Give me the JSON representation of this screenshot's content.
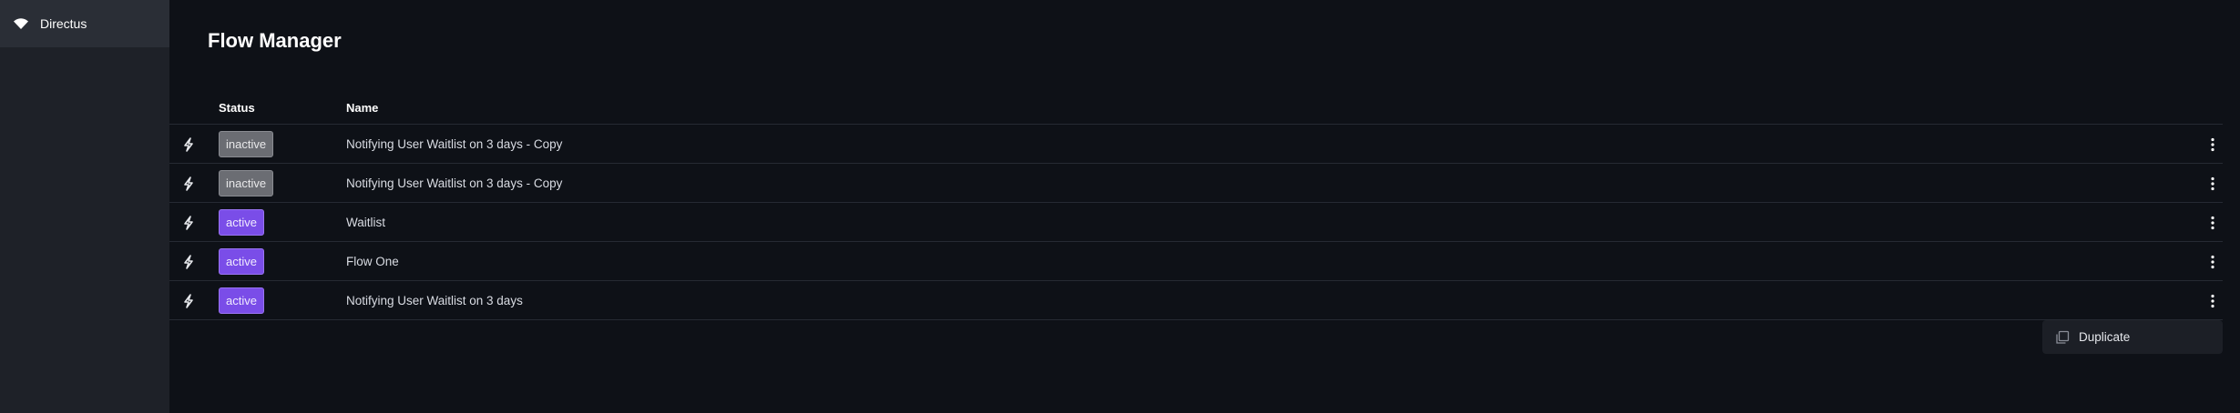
{
  "sidebar": {
    "brand_label": "Directus",
    "brand_icon": "wifi-logo-icon"
  },
  "page": {
    "title": "Flow Manager"
  },
  "table": {
    "headers": {
      "status": "Status",
      "name": "Name"
    },
    "rows": [
      {
        "status": "inactive",
        "name": "Notifying User Waitlist on 3 days - Copy",
        "icon": "bolt-icon"
      },
      {
        "status": "inactive",
        "name": "Notifying User Waitlist on 3 days - Copy",
        "icon": "bolt-icon"
      },
      {
        "status": "active",
        "name": "Waitlist",
        "icon": "bolt-icon"
      },
      {
        "status": "active",
        "name": "Flow One",
        "icon": "bolt-icon"
      },
      {
        "status": "active",
        "name": "Notifying User Waitlist on 3 days",
        "icon": "bolt-icon"
      }
    ]
  },
  "context_menu": {
    "items": [
      {
        "label": "Duplicate",
        "icon": "copy-icon"
      }
    ]
  },
  "colors": {
    "background": "#0e1117",
    "sidebar": "#1e2128",
    "active_badge": "#7a4de8",
    "inactive_badge": "#6b6d73"
  }
}
